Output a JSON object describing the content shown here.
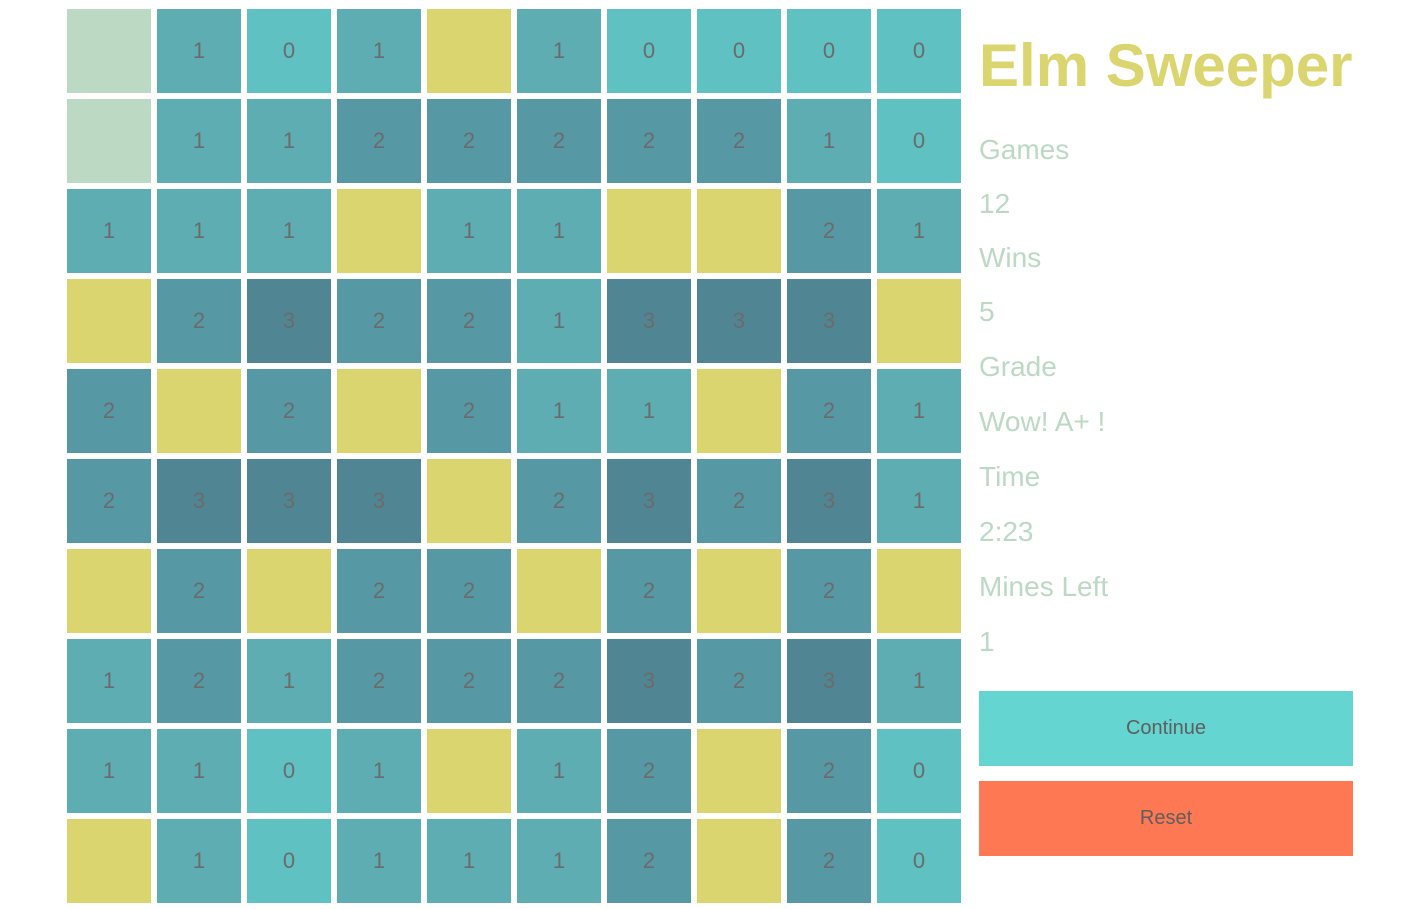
{
  "title": "Elm Sweeper",
  "colors": {
    "count_0": "#5fc1c1",
    "count_1": "#5dadb3",
    "count_2": "#5699a4",
    "count_3": "#508693",
    "mine": "#dbd56f",
    "hidden": "#bcd9c3",
    "title": "#dbd56f",
    "stats_text": "#bcd9c3",
    "continue_button": "#65d5d1",
    "reset_button": "#fe7854"
  },
  "board": [
    [
      "H",
      "1",
      "0",
      "1",
      "M",
      "1",
      "0",
      "0",
      "0",
      "0"
    ],
    [
      "H",
      "1",
      "1",
      "2",
      "2",
      "2",
      "2",
      "2",
      "1",
      "0"
    ],
    [
      "1",
      "1",
      "1",
      "M",
      "1",
      "1",
      "M",
      "M",
      "2",
      "1"
    ],
    [
      "M",
      "2",
      "3",
      "2",
      "2",
      "1",
      "3",
      "3",
      "3",
      "M"
    ],
    [
      "2",
      "M",
      "2",
      "M",
      "2",
      "1",
      "1",
      "M",
      "2",
      "1"
    ],
    [
      "2",
      "3",
      "3",
      "3",
      "M",
      "2",
      "3",
      "2",
      "3",
      "1"
    ],
    [
      "M",
      "2",
      "M",
      "2",
      "2",
      "M",
      "2",
      "M",
      "2",
      "M"
    ],
    [
      "1",
      "2",
      "1",
      "2",
      "2",
      "2",
      "3",
      "2",
      "3",
      "1"
    ],
    [
      "1",
      "1",
      "0",
      "1",
      "M",
      "1",
      "2",
      "M",
      "2",
      "0"
    ],
    [
      "M",
      "1",
      "0",
      "1",
      "1",
      "1",
      "2",
      "M",
      "2",
      "0"
    ]
  ],
  "stats": {
    "games_label": "Games",
    "games_value": "12",
    "wins_label": "Wins",
    "wins_value": "5",
    "grade_label": "Grade",
    "grade_value": "Wow! A+ !",
    "time_label": "Time",
    "time_value": "2:23",
    "mines_left_label": "Mines Left",
    "mines_left_value": "1"
  },
  "buttons": {
    "continue_label": "Continue",
    "reset_label": "Reset"
  }
}
